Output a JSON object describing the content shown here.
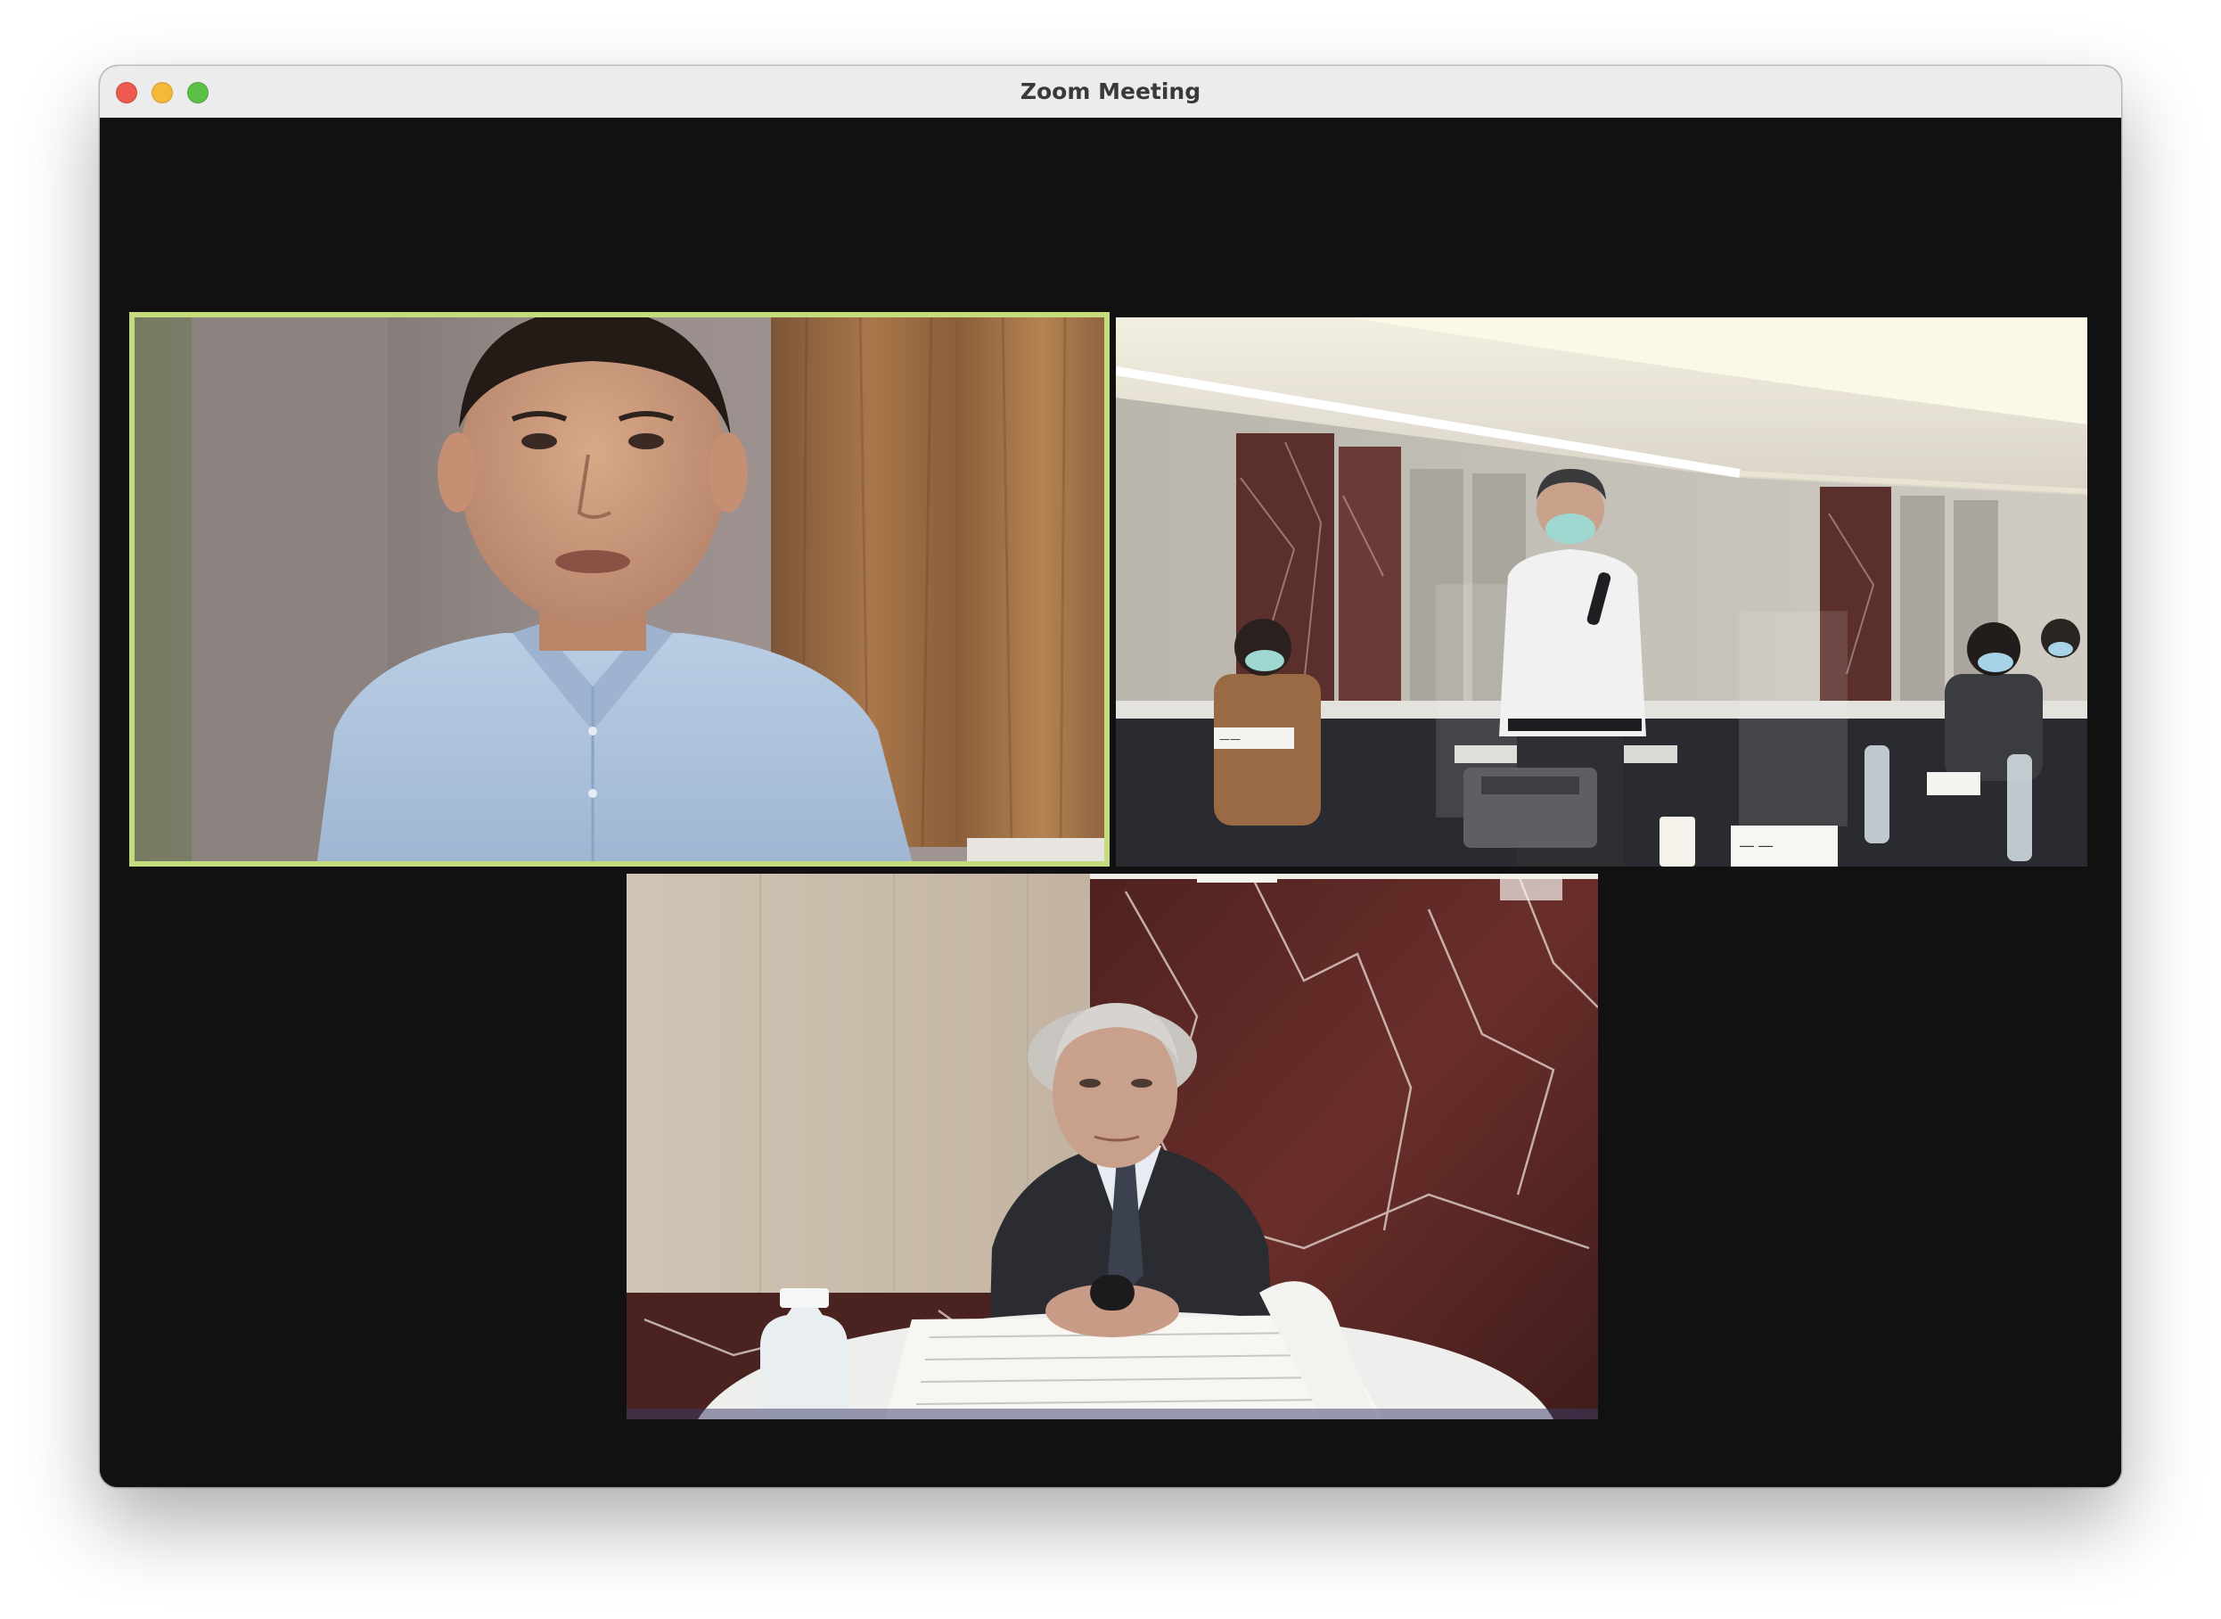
{
  "window": {
    "title": "Zoom Meeting"
  },
  "traffic_lights": {
    "close": "close-button",
    "minimize": "minimize-button",
    "maximize": "maximize-button"
  },
  "participants": [
    {
      "id": "participant-1",
      "active_speaker": true
    },
    {
      "id": "participant-2",
      "active_speaker": false
    },
    {
      "id": "participant-3",
      "active_speaker": false
    }
  ],
  "colors": {
    "active_speaker_border": "#c4dc7c",
    "gallery_background": "#111111",
    "titlebar": "#ececec"
  }
}
